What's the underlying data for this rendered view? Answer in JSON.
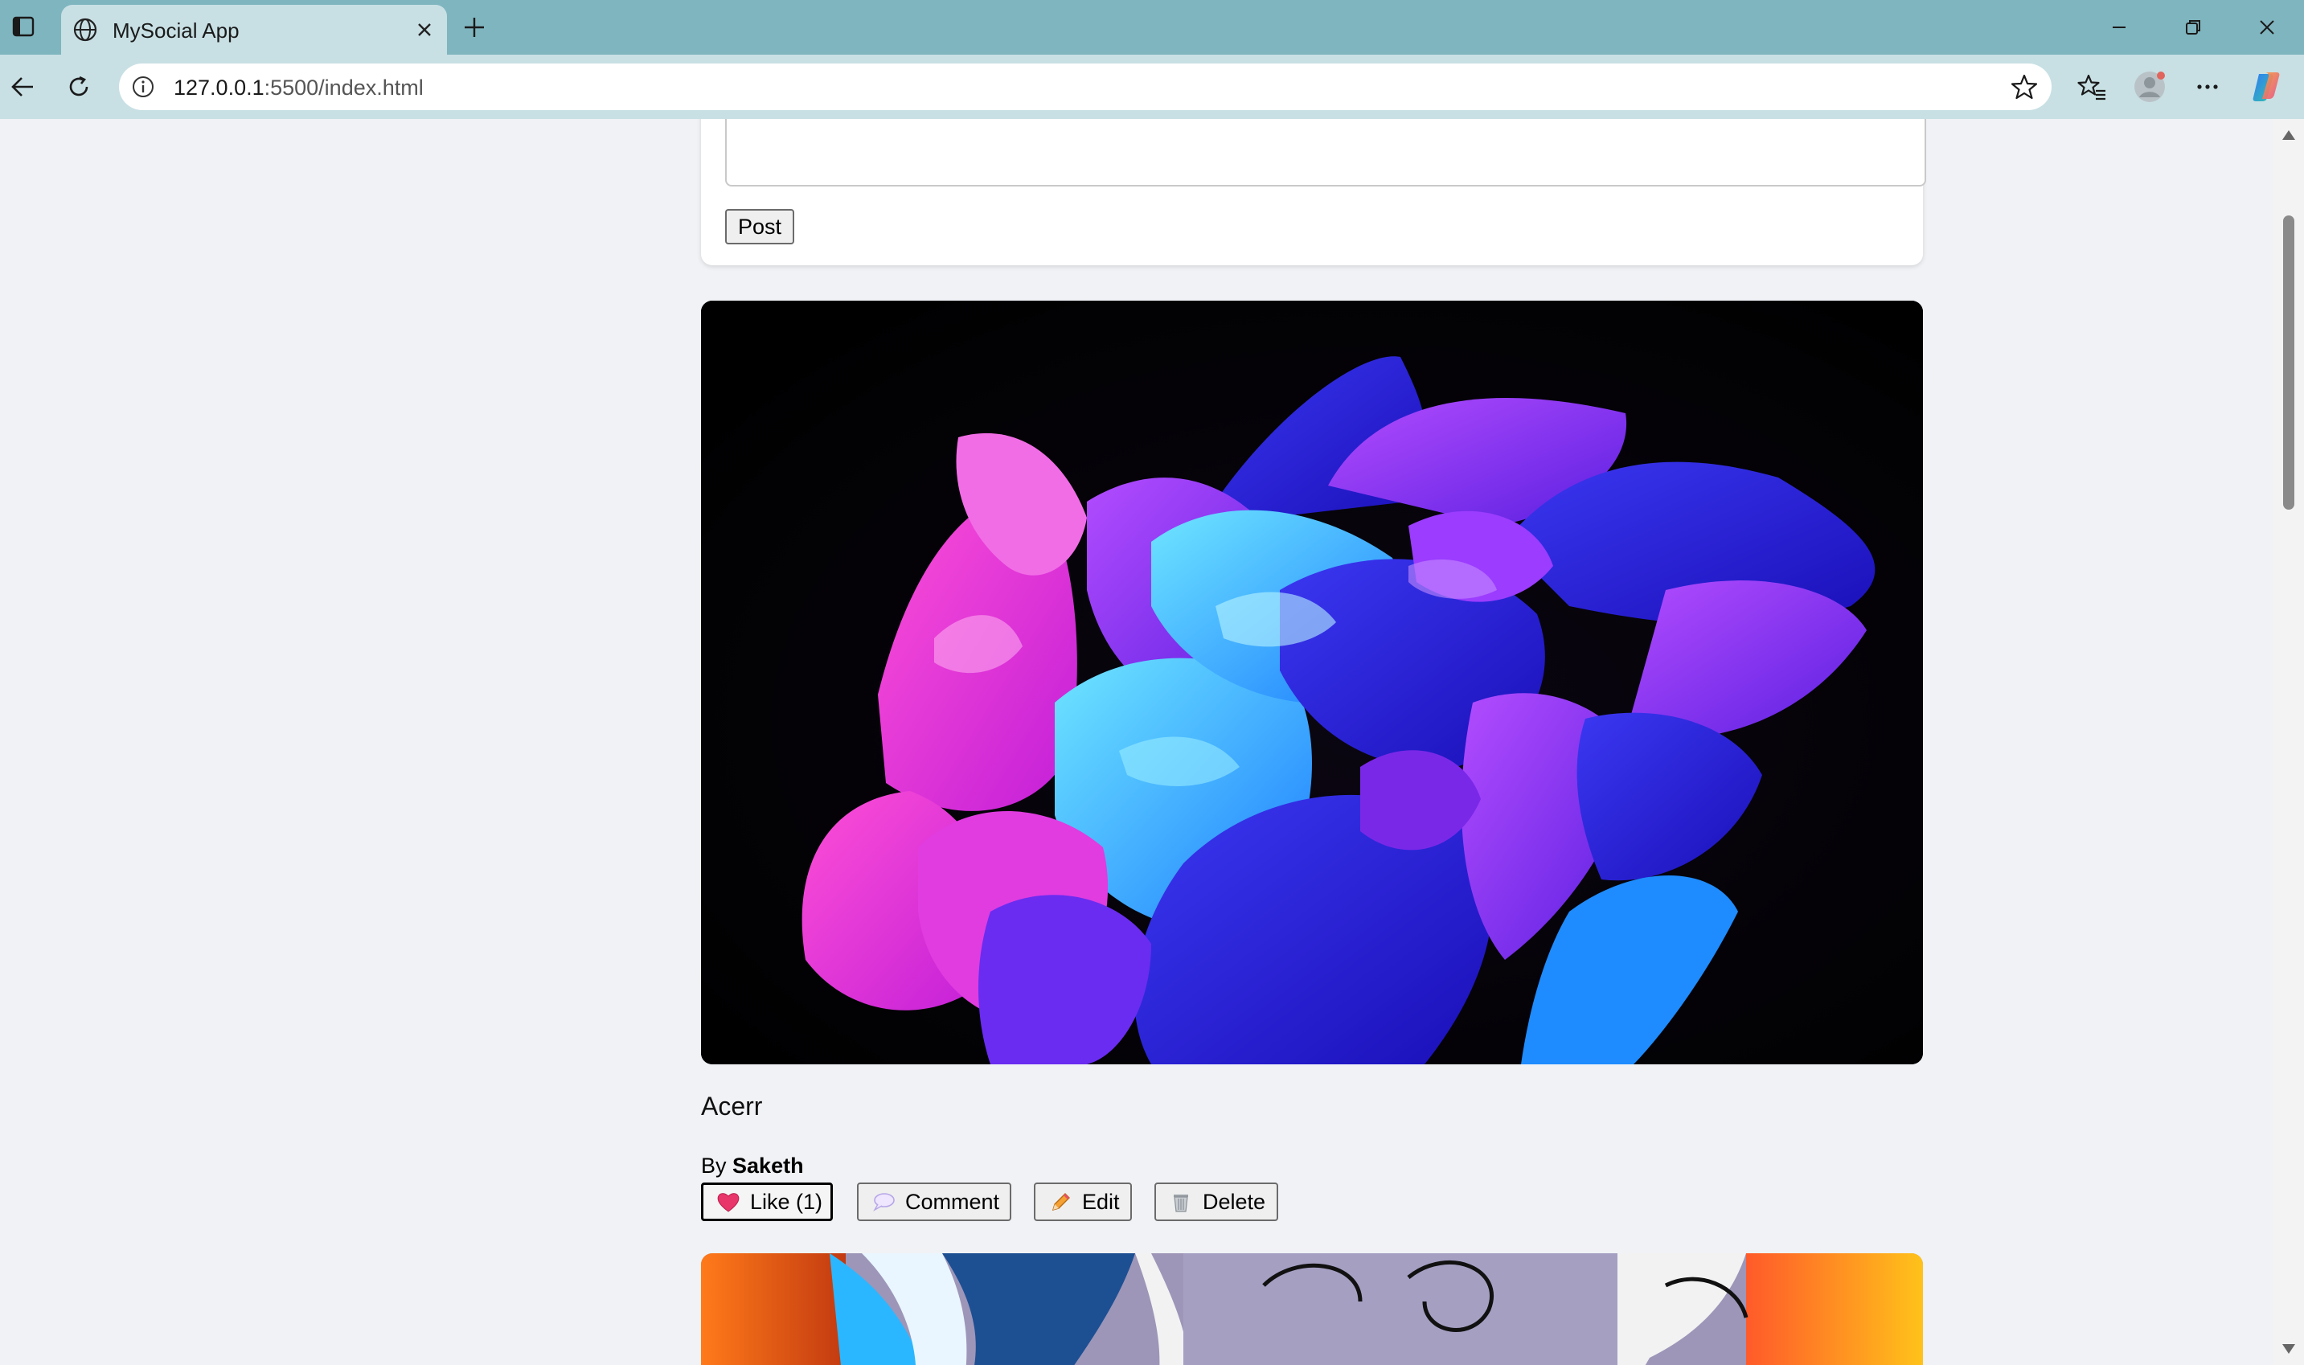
{
  "browser": {
    "tab_title": "MySocial App",
    "url_host": "127.0.0.1",
    "url_rest": ":5500/index.html"
  },
  "composer": {
    "post_label": "Post"
  },
  "post": {
    "caption": "Acerr",
    "byline_prefix": "By",
    "author": "Saketh",
    "like_label": "Like (1)",
    "comment_label": "Comment",
    "edit_label": "Edit",
    "delete_label": "Delete"
  }
}
